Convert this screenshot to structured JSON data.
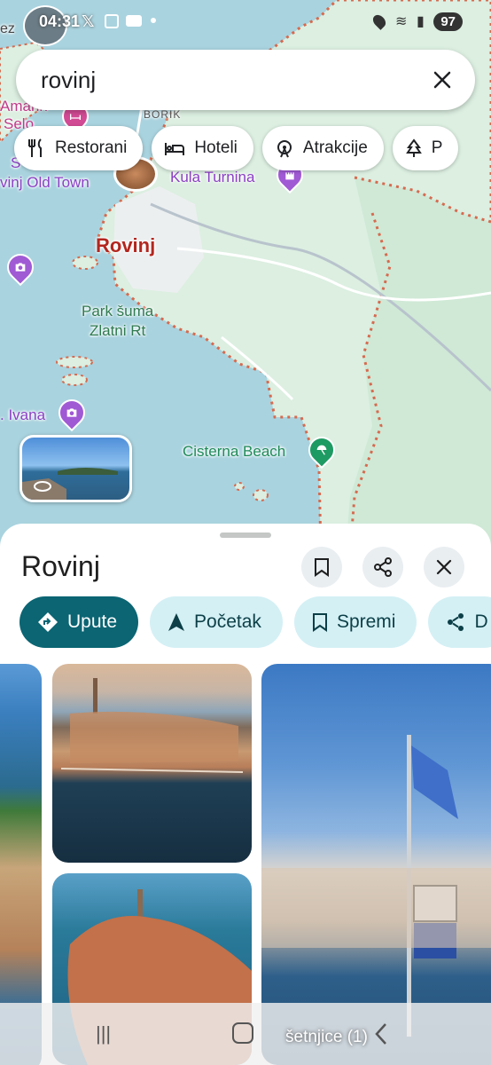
{
  "status_bar": {
    "time": "04:31",
    "battery": "97"
  },
  "search": {
    "query": "rovinj"
  },
  "chips": [
    {
      "label": "Restorani",
      "icon": "fork-knife-icon"
    },
    {
      "label": "Hoteli",
      "icon": "bed-icon"
    },
    {
      "label": "Atrakcije",
      "icon": "ferris-wheel-icon"
    },
    {
      "label": "P",
      "icon": "tree-icon"
    }
  ],
  "map": {
    "labels": {
      "town": "Rovinj",
      "park": "Park šuma\nZlatni Rt",
      "kula": "Kula Turnina",
      "old_town": "vinj Old Town",
      "beach": "Cisterna Beach",
      "borik": "BORIK",
      "amarin": "Amarin",
      "selo": "Selo",
      "ivana": ". Ivana",
      "ez": "ez",
      "s": "S"
    }
  },
  "place": {
    "title": "Rovinj",
    "actions": [
      {
        "label": "Upute",
        "icon": "directions-icon",
        "primary": true
      },
      {
        "label": "Početak",
        "icon": "navigation-arrow-icon",
        "primary": false
      },
      {
        "label": "Spremi",
        "icon": "bookmark-icon",
        "primary": false
      },
      {
        "label": "D",
        "icon": "share-icon",
        "primary": false
      }
    ]
  },
  "navbar": {
    "toast": "šetnjice (1)"
  },
  "colors": {
    "primary": "#0b6573",
    "secondary": "#d4f0f5",
    "water": "#a9d3df",
    "land": "#dcefe1"
  }
}
